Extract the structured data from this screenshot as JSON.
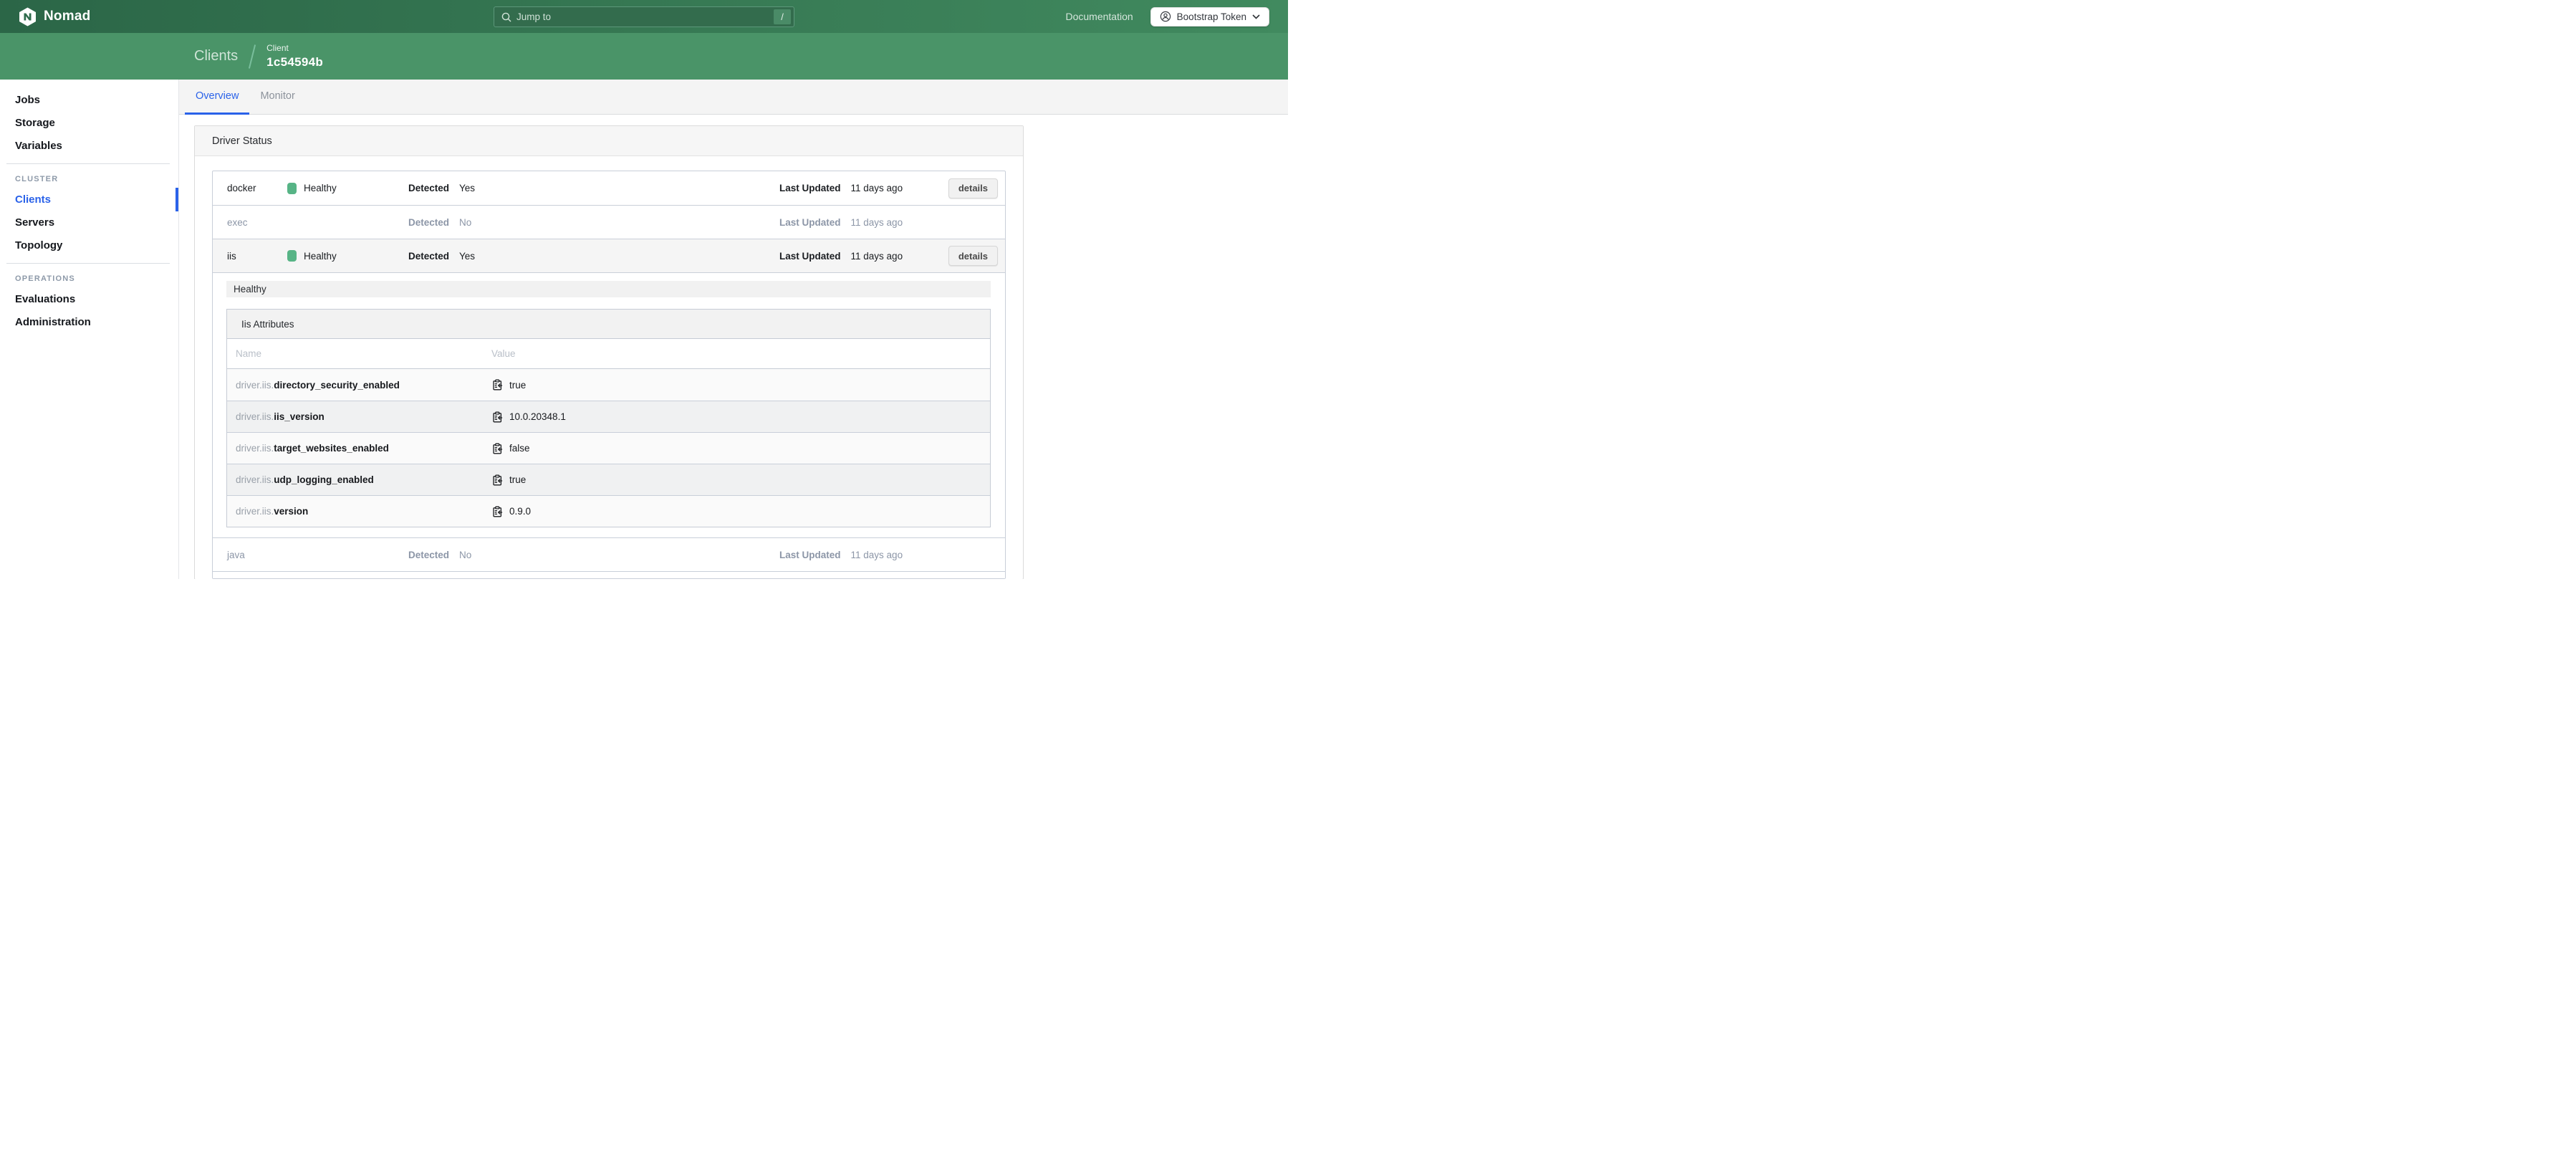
{
  "colors": {
    "navbar_green_left": "#2b6647",
    "navbar_green_right": "#418a5f",
    "subnav_green": "#4a9468",
    "accent_blue": "#2a62e9",
    "healthy_green": "#57b486",
    "muted_bluegray": "#8c96a7"
  },
  "navbar": {
    "brand": "Nomad",
    "search": {
      "placeholder": "Jump to",
      "shortcut_key": "/"
    },
    "documentation_label": "Documentation",
    "token_button_label": "Bootstrap Token"
  },
  "breadcrumb": {
    "section": "Clients",
    "entity_label": "Client",
    "entity_id": "1c54594b"
  },
  "sidebar": {
    "primary": [
      {
        "label": "Jobs"
      },
      {
        "label": "Storage"
      },
      {
        "label": "Variables"
      }
    ],
    "groups": [
      {
        "label": "CLUSTER",
        "items": [
          {
            "label": "Clients",
            "active": true
          },
          {
            "label": "Servers",
            "active": false
          },
          {
            "label": "Topology",
            "active": false
          }
        ]
      },
      {
        "label": "OPERATIONS",
        "items": [
          {
            "label": "Evaluations",
            "active": false
          },
          {
            "label": "Administration",
            "active": false
          }
        ]
      }
    ]
  },
  "tabs": [
    {
      "label": "Overview",
      "active": true
    },
    {
      "label": "Monitor",
      "active": false
    }
  ],
  "panel": {
    "title": "Driver Status",
    "labels": {
      "detected": "Detected",
      "last_updated": "Last Updated",
      "details_button": "details"
    },
    "drivers": [
      {
        "name": "docker",
        "healthy": true,
        "health_label": "Healthy",
        "detected": "Yes",
        "last_updated": "11 days ago",
        "has_details_button": true,
        "expanded": false
      },
      {
        "name": "exec",
        "healthy": false,
        "detected": "No",
        "last_updated": "11 days ago",
        "has_details_button": false,
        "expanded": false
      },
      {
        "name": "iis",
        "healthy": true,
        "health_label": "Healthy",
        "detected": "Yes",
        "last_updated": "11 days ago",
        "has_details_button": true,
        "expanded": true,
        "health_banner": "Healthy",
        "attributes": {
          "title": "Iis Attributes",
          "columns": [
            "Name",
            "Value"
          ],
          "rows": [
            {
              "prefix": "driver.iis.",
              "name": "directory_security_enabled",
              "value": "true"
            },
            {
              "prefix": "driver.iis.",
              "name": "iis_version",
              "value": "10.0.20348.1"
            },
            {
              "prefix": "driver.iis.",
              "name": "target_websites_enabled",
              "value": "false"
            },
            {
              "prefix": "driver.iis.",
              "name": "udp_logging_enabled",
              "value": "true"
            },
            {
              "prefix": "driver.iis.",
              "name": "version",
              "value": "0.9.0"
            }
          ]
        }
      },
      {
        "name": "java",
        "healthy": false,
        "detected": "No",
        "last_updated": "11 days ago",
        "has_details_button": false,
        "expanded": false
      }
    ]
  }
}
